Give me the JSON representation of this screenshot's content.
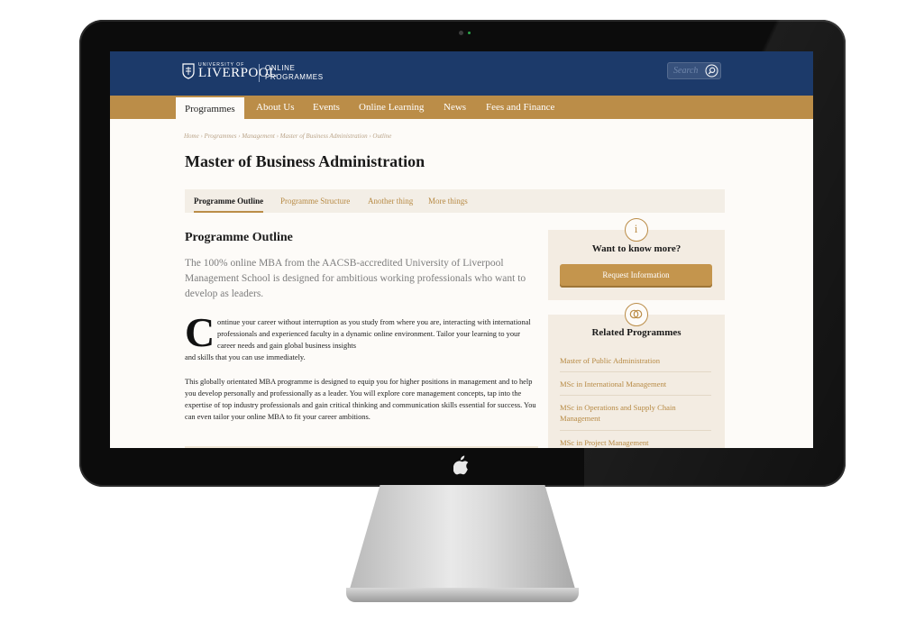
{
  "site": {
    "logo_small": "UNIVERSITY OF",
    "logo_big": "LIVERPOOL",
    "logo_sub": "ONLINE PROGRAMMES",
    "search_placeholder": "Search"
  },
  "nav": {
    "items": [
      {
        "label": "Programmes",
        "active": true
      },
      {
        "label": "About Us"
      },
      {
        "label": "Events"
      },
      {
        "label": "Online Learning"
      },
      {
        "label": "News"
      },
      {
        "label": "Fees and Finance"
      }
    ]
  },
  "breadcrumb": "Home  ›  Programmes  ›  Management  ›  Master of Business Administration  ›  Outline",
  "page_title": "Master of Business Administration",
  "tabs": [
    {
      "label": "Programme Outline",
      "active": true
    },
    {
      "label": "Programme Structure"
    },
    {
      "label": "Another thing"
    },
    {
      "label": "More things"
    }
  ],
  "content": {
    "heading": "Programme Outline",
    "lead": "The 100% online MBA from the AACSB-accredited University of Liverpool Management School is designed for ambitious working professionals who want to develop as leaders.",
    "dropcap": "C",
    "para1_top": "ontinue your career without interruption as you study from where you are, interacting with international professionals and experienced faculty in a dynamic online environment. Tailor your learning to your career needs and gain global business insights",
    "para1_bottom": "and skills that you can use immediately.",
    "para2": "This globally orientated MBA programme is designed to equip you for higher positions in management and to help you develop personally and professionally as a leader. You will explore core management concepts, tap into the expertise of top industry professionals and gain critical thinking and communication skills essential for success. You can even tailor your online MBA to fit your career ambitions."
  },
  "sidebar": {
    "want_title": "Want to know more?",
    "info_glyph": "i",
    "request_label": "Request Information",
    "related_title": "Related Programmes",
    "related_items": [
      "Master of Public Administration",
      "MSc in International Management",
      "MSc in Operations and Supply Chain Management",
      "MSc in Project Management"
    ]
  },
  "colors": {
    "header_blue": "#1c3a6a",
    "nav_gold": "#bb8d48",
    "link_gold": "#b78a44",
    "panel_beige": "#f3ece2"
  },
  "icons": [
    "crest-icon",
    "search-icon",
    "info-icon",
    "rings-icon",
    "apple-logo-icon"
  ]
}
